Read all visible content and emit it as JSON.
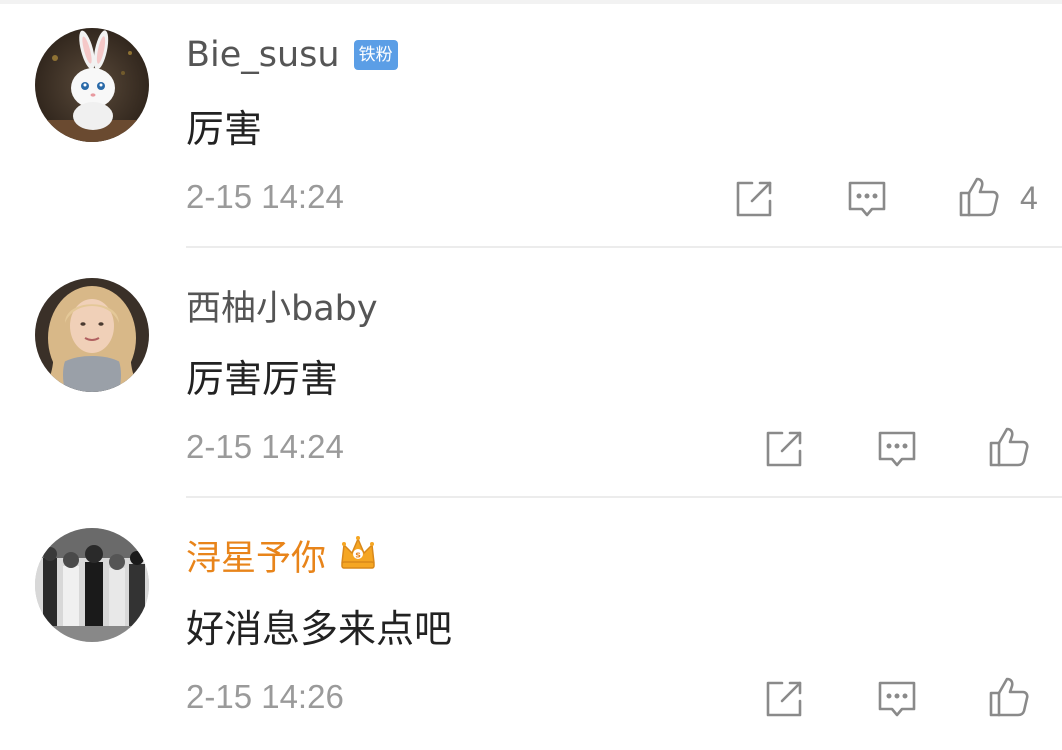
{
  "comments": [
    {
      "username": "Bie_susu",
      "badge": "铁粉",
      "text": "厉害",
      "time": "2-15 14:24",
      "likes": "4",
      "avatar": "white-rabbit-avatar",
      "name_color": "#555555"
    },
    {
      "username": "西柚小baby",
      "text": "厉害厉害",
      "time": "2-15 14:24",
      "avatar": "blonde-girl-avatar",
      "name_color": "#555555"
    },
    {
      "username": "浔星予你",
      "vip_icon": "crown-icon",
      "text": "好消息多来点吧",
      "time": "2-15 14:26",
      "avatar": "bw-crowd-avatar",
      "name_color": "#e8841a"
    }
  ],
  "icons": {
    "repost": "repost-icon",
    "reply": "comment-icon",
    "like": "thumbs-up-icon"
  },
  "colors": {
    "badge_bg": "#5b9ee6",
    "vip_name": "#e8841a",
    "icon_gray": "#8a8a8a"
  }
}
